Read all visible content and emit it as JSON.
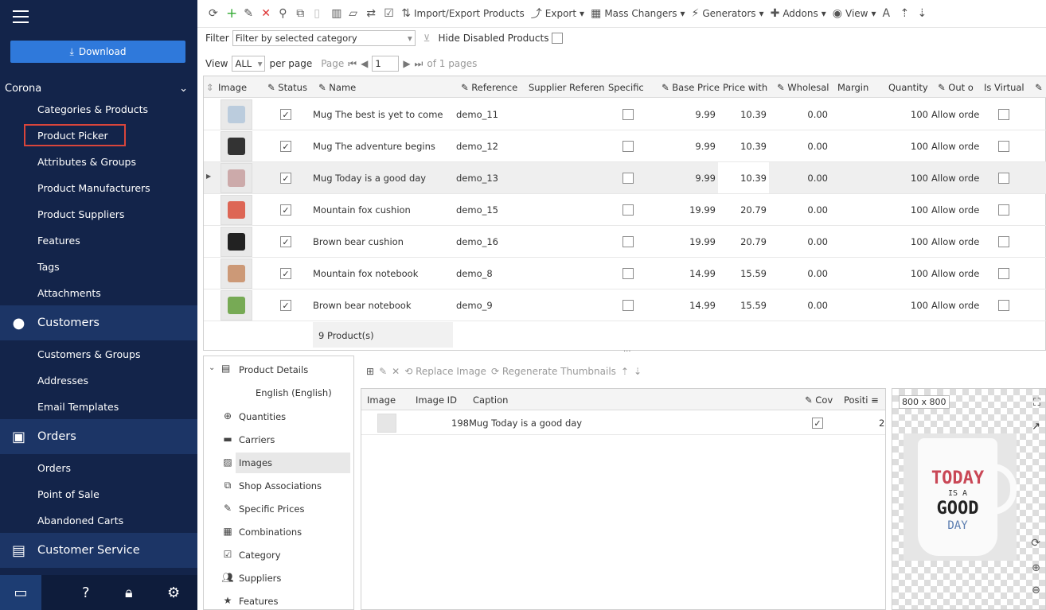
{
  "sidebar": {
    "download": "Download",
    "store": "Corona",
    "sub1": [
      "Categories & Products",
      "Product Picker",
      "Attributes & Groups",
      "Product Manufacturers",
      "Product Suppliers",
      "Features",
      "Tags",
      "Attachments"
    ],
    "customers": "Customers",
    "sub2": [
      "Customers & Groups",
      "Addresses",
      "Email Templates"
    ],
    "orders": "Orders",
    "sub3": [
      "Orders",
      "Point of Sale",
      "Abandoned Carts"
    ],
    "service": "Customer Service"
  },
  "toolbar": {
    "import_export": "Import/Export Products",
    "export": "Export",
    "mass": "Mass Changers",
    "gen": "Generators",
    "addons": "Addons",
    "view": "View"
  },
  "filter": {
    "label": "Filter",
    "value": "Filter by selected category",
    "hide_disabled": "Hide Disabled Products"
  },
  "pager": {
    "view": "View",
    "per_page_value": "ALL",
    "per_page": "per page",
    "page": "Page",
    "page_value": "1",
    "of_pages": "of 1 pages"
  },
  "grid": {
    "columns": [
      "Image",
      "Status",
      "Name",
      "Reference",
      "Supplier Referen",
      "Specific",
      "Base Price",
      "Price with",
      "Wholesal",
      "Margin",
      "Quantity",
      "Out o",
      "Is Virtual"
    ],
    "rows": [
      {
        "name": "Mug The best is yet to come",
        "ref": "demo_11",
        "base": "9.99",
        "with": "10.39",
        "wholesale": "0.00",
        "qty": "100",
        "out": "Allow orde",
        "color": "#bcd"
      },
      {
        "name": "Mug The adventure begins",
        "ref": "demo_12",
        "base": "9.99",
        "with": "10.39",
        "wholesale": "0.00",
        "qty": "100",
        "out": "Allow orde",
        "color": "#333"
      },
      {
        "name": "Mug Today is a good day",
        "ref": "demo_13",
        "base": "9.99",
        "with": "10.39",
        "wholesale": "0.00",
        "qty": "100",
        "out": "Allow orde",
        "color": "#caa"
      },
      {
        "name": "Mountain fox cushion",
        "ref": "demo_15",
        "base": "19.99",
        "with": "20.79",
        "wholesale": "0.00",
        "qty": "100",
        "out": "Allow orde",
        "color": "#d65"
      },
      {
        "name": "Brown bear cushion",
        "ref": "demo_16",
        "base": "19.99",
        "with": "20.79",
        "wholesale": "0.00",
        "qty": "100",
        "out": "Allow orde",
        "color": "#222"
      },
      {
        "name": "Mountain fox notebook",
        "ref": "demo_8",
        "base": "14.99",
        "with": "15.59",
        "wholesale": "0.00",
        "qty": "100",
        "out": "Allow orde",
        "color": "#c97"
      },
      {
        "name": "Brown bear notebook",
        "ref": "demo_9",
        "base": "14.99",
        "with": "15.59",
        "wholesale": "0.00",
        "qty": "100",
        "out": "Allow orde",
        "color": "#7a5"
      }
    ],
    "footer": "9 Product(s)"
  },
  "tree": {
    "root": "Product Details",
    "lang": "English (English)",
    "items": [
      "Quantities",
      "Carriers",
      "Images",
      "Shop Associations",
      "Specific Prices",
      "Combinations",
      "Category",
      "Suppliers",
      "Features"
    ]
  },
  "images": {
    "replace": "Replace Image",
    "regen": "Regenerate Thumbnails",
    "columns": [
      "Image",
      "Image ID",
      "Caption",
      "Cov",
      "Positi"
    ],
    "row": {
      "id": "198",
      "caption": "Mug Today is a good day",
      "pos": "2"
    },
    "size": "800 x 800",
    "mug": {
      "l1": "TODAY",
      "l2": "IS A",
      "l3": "GOOD",
      "l4": "DAY"
    }
  }
}
